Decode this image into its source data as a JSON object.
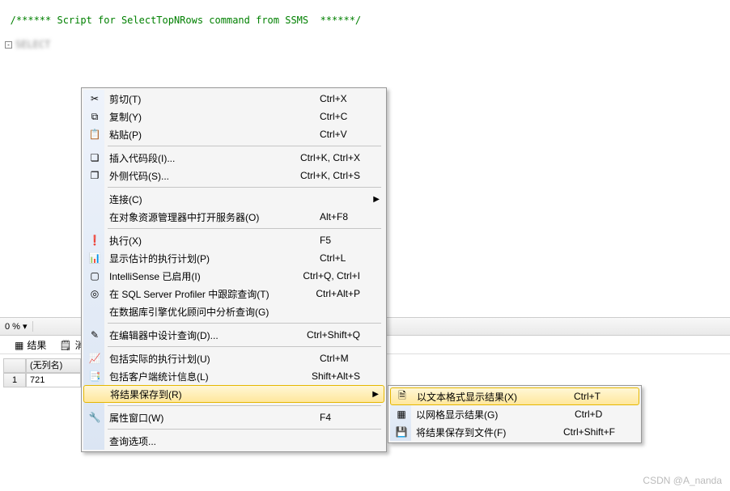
{
  "editor": {
    "comment": "/****** Script for SelectTopNRows command from SSMS  ******/",
    "keyword": "SELECT"
  },
  "toolbar": {
    "zoom": "0 %",
    "zoom_arrow": "▾"
  },
  "tabs": {
    "results_label": "结果",
    "messages_label": "消息"
  },
  "grid": {
    "header": "(无列名)",
    "row_index": "1",
    "value": "721"
  },
  "main_menu": [
    {
      "icon": "cut-icon",
      "label": "剪切(T)",
      "shortcut": "Ctrl+X"
    },
    {
      "icon": "copy-icon",
      "label": "复制(Y)",
      "shortcut": "Ctrl+C"
    },
    {
      "icon": "paste-icon",
      "label": "粘贴(P)",
      "shortcut": "Ctrl+V"
    },
    {
      "sep": true
    },
    {
      "icon": "snippet-icon",
      "label": "插入代码段(I)...",
      "shortcut": "Ctrl+K, Ctrl+X"
    },
    {
      "icon": "surround-icon",
      "label": "外侧代码(S)...",
      "shortcut": "Ctrl+K, Ctrl+S"
    },
    {
      "sep": true
    },
    {
      "icon": "",
      "label": "连接(C)",
      "shortcut": "",
      "submenu": true
    },
    {
      "icon": "",
      "label": "在对象资源管理器中打开服务器(O)",
      "shortcut": "Alt+F8"
    },
    {
      "sep": true
    },
    {
      "icon": "execute-icon",
      "label": "执行(X)",
      "shortcut": "F5"
    },
    {
      "icon": "plan-est-icon",
      "label": "显示估计的执行计划(P)",
      "shortcut": "Ctrl+L"
    },
    {
      "icon": "intellisense-icon",
      "label": "IntelliSense 已启用(I)",
      "shortcut": "Ctrl+Q, Ctrl+I"
    },
    {
      "icon": "profiler-icon",
      "label": "在 SQL Server Profiler 中跟踪查询(T)",
      "shortcut": "Ctrl+Alt+P"
    },
    {
      "icon": "",
      "label": "在数据库引擎优化顾问中分析查询(G)",
      "shortcut": ""
    },
    {
      "sep": true
    },
    {
      "icon": "designer-icon",
      "label": "在编辑器中设计查询(D)...",
      "shortcut": "Ctrl+Shift+Q"
    },
    {
      "sep": true
    },
    {
      "icon": "actual-plan-icon",
      "label": "包括实际的执行计划(U)",
      "shortcut": "Ctrl+M"
    },
    {
      "icon": "client-stats-icon",
      "label": "包括客户端统计信息(L)",
      "shortcut": "Shift+Alt+S"
    },
    {
      "icon": "",
      "label": "将结果保存到(R)",
      "shortcut": "",
      "submenu": true,
      "highlight": true
    },
    {
      "sep": true
    },
    {
      "icon": "properties-icon",
      "label": "属性窗口(W)",
      "shortcut": "F4"
    },
    {
      "sep": true
    },
    {
      "icon": "",
      "label": "查询选项...",
      "shortcut": ""
    }
  ],
  "sub_menu": [
    {
      "icon": "results-text-icon",
      "label": "以文本格式显示结果(X)",
      "shortcut": "Ctrl+T",
      "highlight": true
    },
    {
      "icon": "results-grid-icon",
      "label": "以网格显示结果(G)",
      "shortcut": "Ctrl+D"
    },
    {
      "icon": "results-file-icon",
      "label": "将结果保存到文件(F)",
      "shortcut": "Ctrl+Shift+F"
    }
  ],
  "watermark": "CSDN @A_nanda"
}
